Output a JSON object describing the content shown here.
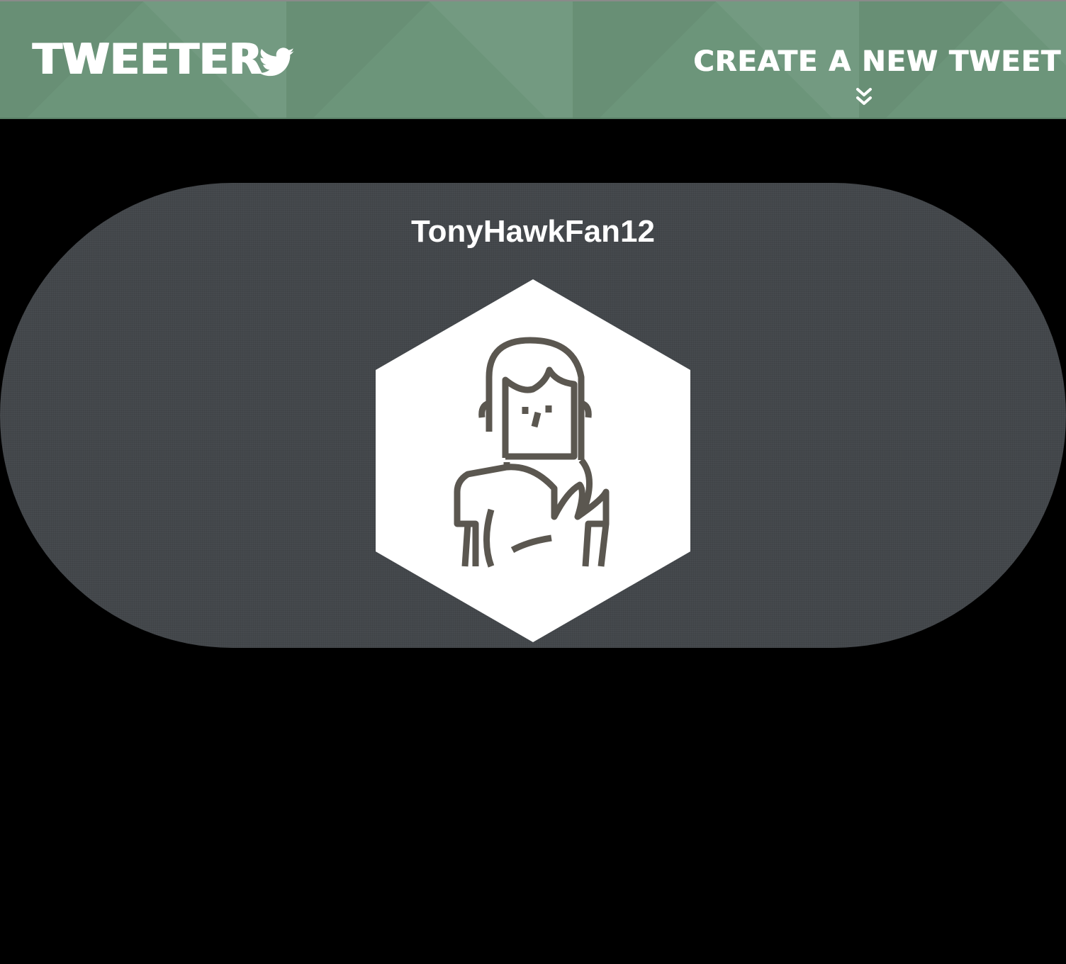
{
  "navbar": {
    "brand": {
      "label": "TWEETER",
      "icon": "twitter-bird-icon"
    },
    "create_tweet": {
      "label": "CREATE A NEW TWEET",
      "icon": "double-chevron-down-icon"
    }
  },
  "profile": {
    "username": "TonyHawkFan12",
    "avatar_icon": "woman-avatar-icon"
  },
  "colors": {
    "navbar_bg": "#6c957a",
    "card_bg": "#43474b",
    "page_bg": "#000000",
    "avatar_bg": "#ffffff",
    "avatar_stroke": "#5b5750"
  }
}
